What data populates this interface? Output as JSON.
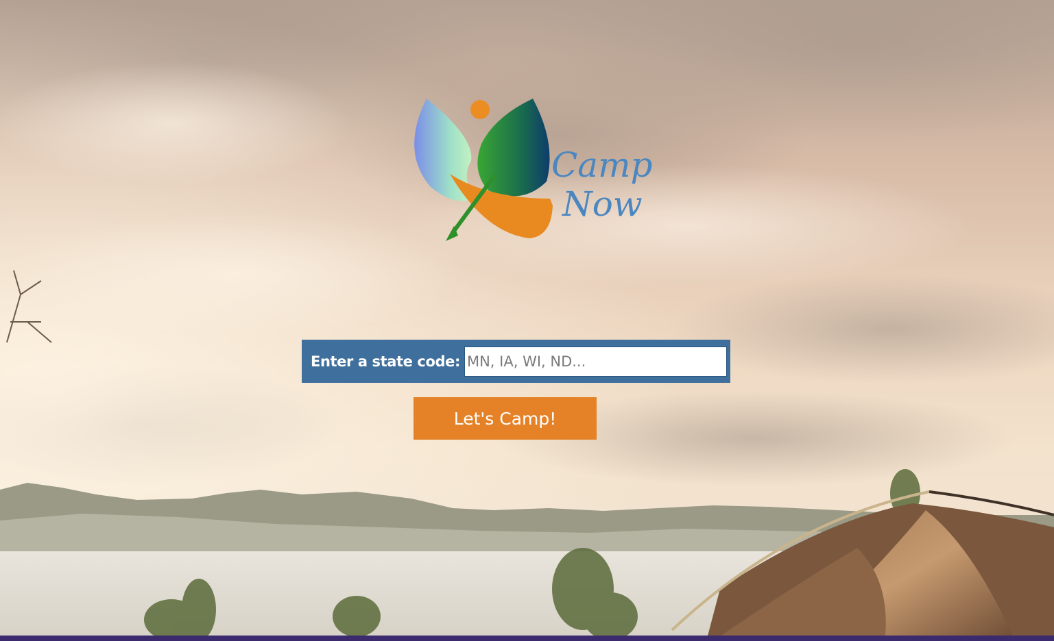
{
  "brand": {
    "logo_text_line1": "Camp",
    "logo_text_line2": "Now",
    "logo_text_color": "#4a86c0",
    "sun_color": "#ec8d24",
    "canoe_color": "#e88a1f",
    "paddle_color": "#2f8f2a"
  },
  "search": {
    "label": "Enter a state code:",
    "placeholder": "MN, IA, WI, ND...",
    "value": "",
    "bar_color": "#3f6f9c"
  },
  "submit": {
    "label": "Let's Camp!",
    "color": "#e58227"
  },
  "background": {
    "scene": "sunset-sky-mountains-tent"
  }
}
